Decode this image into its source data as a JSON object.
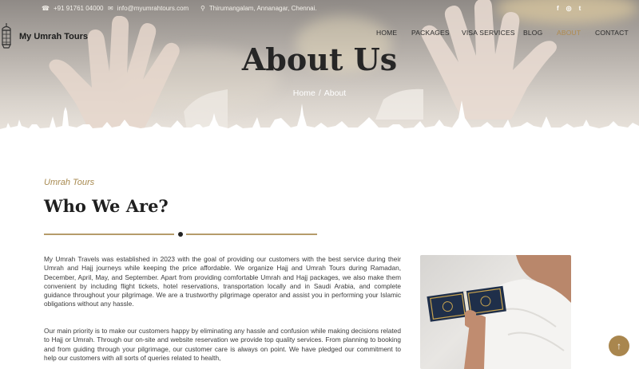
{
  "topbar": {
    "phone": "+91 91761 04000",
    "email": "info@myumrahtours.com",
    "address": "Thirumangalam, Annanagar, Chennai."
  },
  "social": {
    "facebook": "f",
    "instagram": "◎",
    "twitter": "t"
  },
  "brand": {
    "name": "My Umrah Tours"
  },
  "nav": {
    "items": [
      {
        "label": "HOME"
      },
      {
        "label": "PACKAGES"
      },
      {
        "label": "VISA SERVICES"
      },
      {
        "label": "BLOG"
      },
      {
        "label": "ABOUT"
      },
      {
        "label": "CONTACT"
      }
    ],
    "active": "ABOUT"
  },
  "hero": {
    "title": "About Us",
    "breadcrumb": {
      "home": "Home",
      "separator": "/",
      "current": "About"
    }
  },
  "about": {
    "kicker": "Umrah Tours",
    "heading": "Who We Are?",
    "paragraph1": "My Umrah Travels was established in 2023 with the goal of providing our customers with the best service during their Umrah and Hajj journeys while keeping the price affordable. We organize Hajj and Umrah Tours during Ramadan, December, April, May, and September. Apart from providing comfortable Umrah and Hajj packages, we also make them convenient by including flight tickets, hotel reservations, transportation locally and in Saudi Arabia, and complete guidance throughout your pilgrimage. We are a trustworthy pilgrimage operator and assist you in performing your Islamic obligations without any hassle.",
    "paragraph2": "Our main priority is to make our customers happy by eliminating any hassle and confusion while making decisions related to Hajj or Umrah. Through our on-site and website reservation we provide top quality services. From planning to booking and from guiding through your pilgrimage, our customer care is always on point. We have pledged our commitment to help our customers with all sorts of queries related to health,"
  },
  "colors": {
    "accent": "#b08b4f",
    "heading": "#1f1f1f",
    "scroll_button": "#a9864e"
  },
  "icons": {
    "phone": "phone-icon",
    "email": "email-icon",
    "location": "location-pin-icon",
    "scroll_top": "arrow-up-icon"
  }
}
